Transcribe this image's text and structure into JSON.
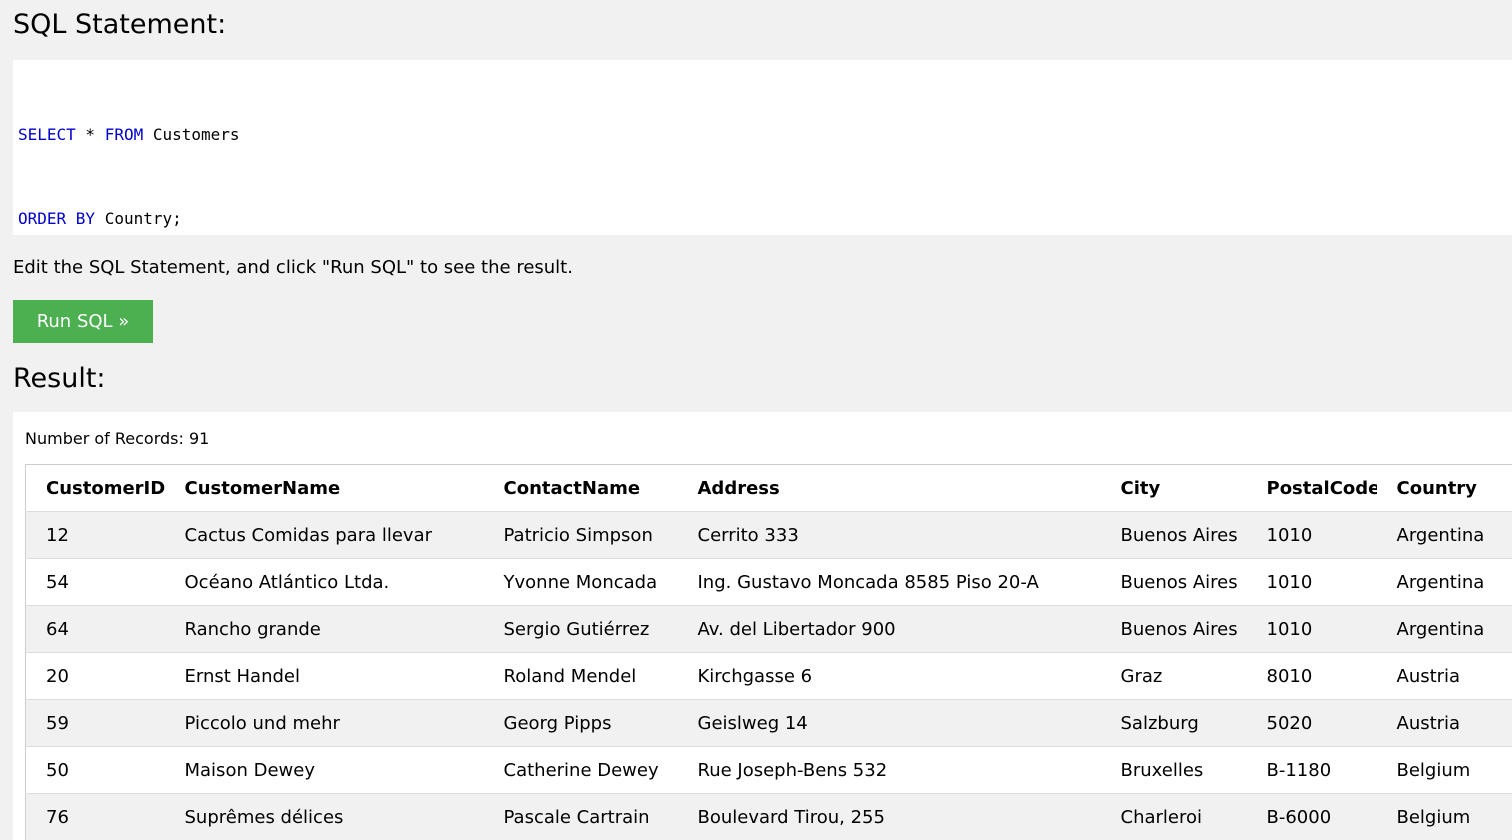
{
  "sql_section": {
    "title": "SQL Statement:",
    "line1": {
      "kw1": "SELECT",
      "plain1": " * ",
      "kw2": "FROM",
      "plain2": " Customers"
    },
    "line2": {
      "kw1": "ORDER BY",
      "plain1": " Country;"
    }
  },
  "hint": "Edit the SQL Statement, and click \"Run SQL\" to see the result.",
  "run_button": {
    "label": "Run SQL »",
    "color": "#4caf50"
  },
  "result_section": {
    "title": "Result:",
    "record_count_label": "Number of Records: ",
    "record_count": "91"
  },
  "table": {
    "headers": [
      "CustomerID",
      "CustomerName",
      "ContactName",
      "Address",
      "City",
      "PostalCode",
      "Country"
    ],
    "rows": [
      [
        "12",
        "Cactus Comidas para llevar",
        "Patricio Simpson",
        "Cerrito 333",
        "Buenos Aires",
        "1010",
        "Argentina"
      ],
      [
        "54",
        "Océano Atlántico Ltda.",
        "Yvonne Moncada",
        "Ing. Gustavo Moncada 8585 Piso 20-A",
        "Buenos Aires",
        "1010",
        "Argentina"
      ],
      [
        "64",
        "Rancho grande",
        "Sergio Gutiérrez",
        "Av. del Libertador 900",
        "Buenos Aires",
        "1010",
        "Argentina"
      ],
      [
        "20",
        "Ernst Handel",
        "Roland Mendel",
        "Kirchgasse 6",
        "Graz",
        "8010",
        "Austria"
      ],
      [
        "59",
        "Piccolo und mehr",
        "Georg Pipps",
        "Geislweg 14",
        "Salzburg",
        "5020",
        "Austria"
      ],
      [
        "50",
        "Maison Dewey",
        "Catherine Dewey",
        "Rue Joseph-Bens 532",
        "Bruxelles",
        "B-1180",
        "Belgium"
      ],
      [
        "76",
        "Suprêmes délices",
        "Pascale Cartrain",
        "Boulevard Tirou, 255",
        "Charleroi",
        "B-6000",
        "Belgium"
      ]
    ]
  },
  "colors": {
    "keyword": "#0000cd",
    "background": "#f1f1f1",
    "panel": "#ffffff"
  }
}
